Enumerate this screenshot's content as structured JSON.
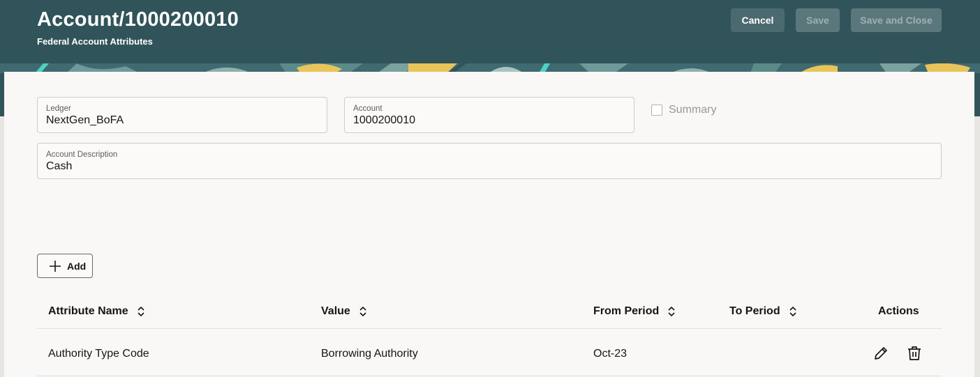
{
  "header": {
    "title": "Account/1000200010",
    "subtitle": "Federal Account Attributes",
    "buttons": {
      "cancel": "Cancel",
      "save": "Save",
      "save_and_close": "Save and Close"
    }
  },
  "form": {
    "ledger": {
      "label": "Ledger",
      "value": "NextGen_BoFA"
    },
    "account": {
      "label": "Account",
      "value": "1000200010"
    },
    "summary": {
      "label": "Summary",
      "checked": false
    },
    "account_description": {
      "label": "Account Description",
      "value": "Cash"
    }
  },
  "toolbar": {
    "add_label": "Add"
  },
  "table": {
    "columns": [
      "Attribute Name",
      "Value",
      "From Period",
      "To Period",
      "Actions"
    ],
    "rows": [
      {
        "attribute_name": "Authority Type Code",
        "value": "Borrowing Authority",
        "from_period": "Oct-23",
        "to_period": ""
      }
    ]
  },
  "icons": {
    "add": "plus-icon",
    "sort": "sort-arrows-icon",
    "edit": "pencil-icon",
    "delete": "trash-icon",
    "checkbox": "checkbox-unchecked-icon"
  },
  "colors": {
    "header_bg": "#31545a",
    "card_bg": "#f9f8f6",
    "banner_yellow": "#e8c55a",
    "banner_teal": "#4fd1c5"
  }
}
